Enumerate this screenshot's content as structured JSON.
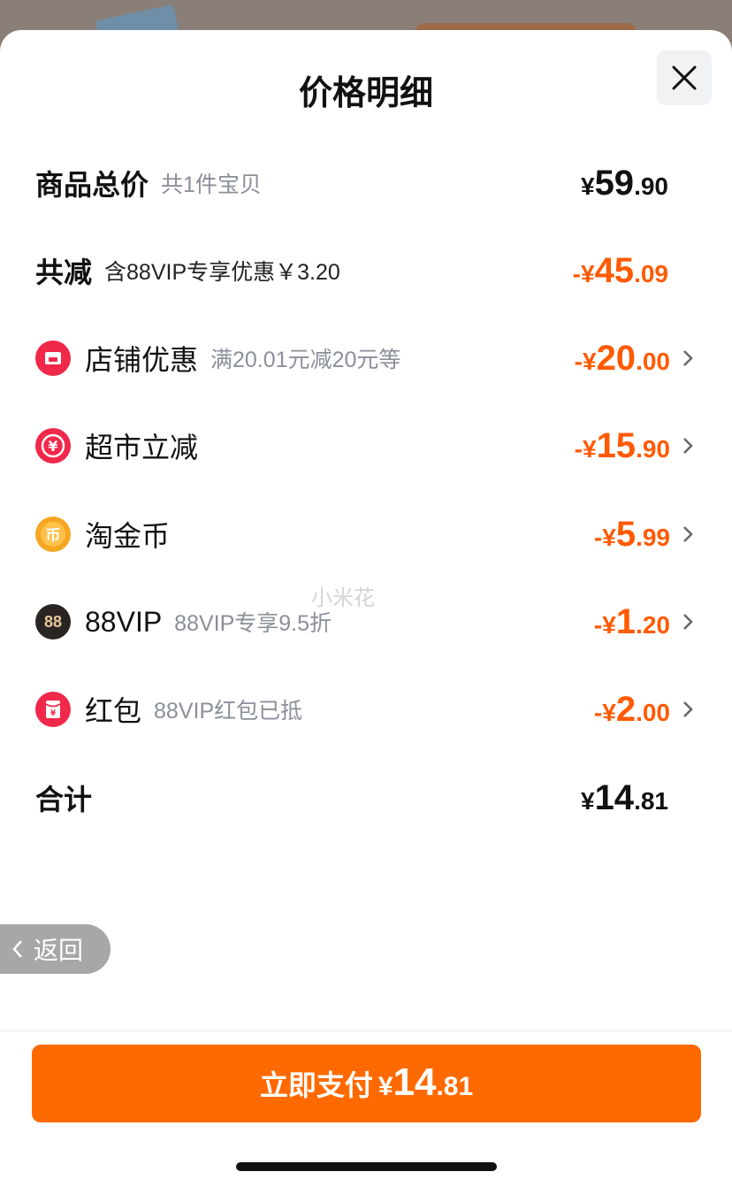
{
  "header": {
    "title": "价格明细"
  },
  "summary": {
    "total": {
      "label": "商品总价",
      "sub": "共1件宝贝",
      "sym": "¥",
      "int": "59",
      "dec": ".90"
    },
    "reduce": {
      "label": "共减",
      "sub": "含88VIP专享优惠￥3.20",
      "sym": "-¥",
      "int": "45",
      "dec": ".09"
    }
  },
  "discounts": [
    {
      "label": "店铺优惠",
      "sub": "满20.01元减20元等",
      "sym": "-¥",
      "int": "20",
      "dec": ".00",
      "icon": "store-icon"
    },
    {
      "label": "超市立减",
      "sub": "",
      "sym": "-¥",
      "int": "15",
      "dec": ".90",
      "icon": "yuan-coin-icon"
    },
    {
      "label": "淘金币",
      "sub": "",
      "sym": "-¥",
      "int": "5",
      "dec": ".99",
      "icon": "gold-coin-icon"
    },
    {
      "label": "88VIP",
      "sub": "88VIP专享9.5折",
      "sym": "-¥",
      "int": "1",
      "dec": ".20",
      "icon": "vip-88-icon",
      "icon_text": "88"
    },
    {
      "label": "红包",
      "sub": "88VIP红包已抵",
      "sym": "-¥",
      "int": "2",
      "dec": ".00",
      "icon": "red-packet-icon"
    }
  ],
  "footer_total": {
    "label": "合计",
    "sym": "¥",
    "int": "14",
    "dec": ".81"
  },
  "back": {
    "label": "返回"
  },
  "pay": {
    "label": "立即支付",
    "sym": "¥",
    "int": "14",
    "dec": ".81"
  },
  "watermark": "小米花",
  "colors": {
    "accent": "#ff6a00",
    "discount_text": "#ff5a00",
    "icon_red": "#f0284a",
    "icon_gold": "#f5a623"
  }
}
